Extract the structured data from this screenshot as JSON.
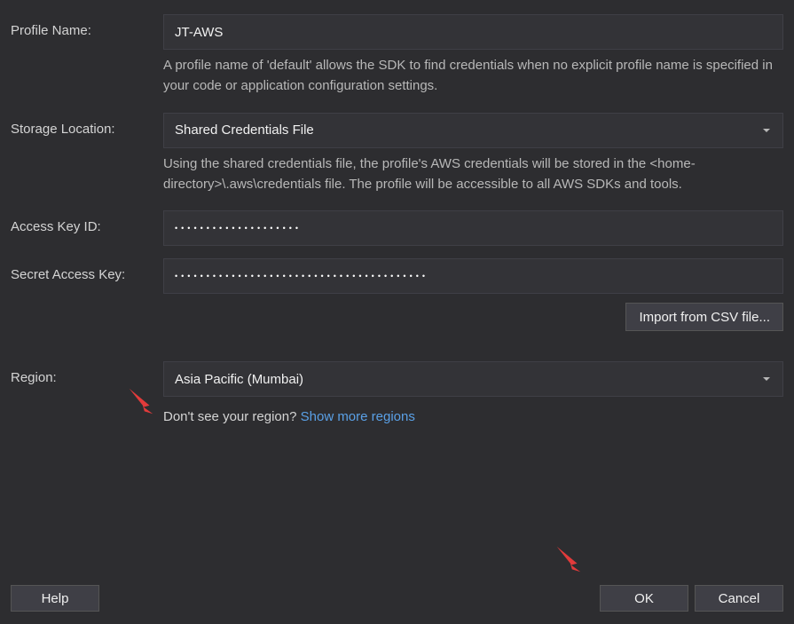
{
  "profile": {
    "label": "Profile Name:",
    "value": "JT-AWS",
    "hint": "A profile name of 'default' allows the SDK to find credentials when no explicit profile name is specified in your code or application configuration settings."
  },
  "storage": {
    "label": "Storage Location:",
    "selected": "Shared Credentials File",
    "hint": "Using the shared credentials file, the profile's AWS credentials will be stored in the <home-directory>\\.aws\\credentials file. The profile will be accessible to all AWS SDKs and tools."
  },
  "accessKey": {
    "label": "Access Key ID:",
    "masked": "••••••••••••••••••••"
  },
  "secretKey": {
    "label": "Secret Access Key:",
    "masked": "••••••••••••••••••••••••••••••••••••••••"
  },
  "import": {
    "label": "Import from CSV file..."
  },
  "region": {
    "label": "Region:",
    "selected": "Asia Pacific (Mumbai)",
    "hintPrefix": "Don't see your region?  ",
    "linkText": "Show more regions"
  },
  "buttons": {
    "help": "Help",
    "ok": "OK",
    "cancel": "Cancel"
  }
}
